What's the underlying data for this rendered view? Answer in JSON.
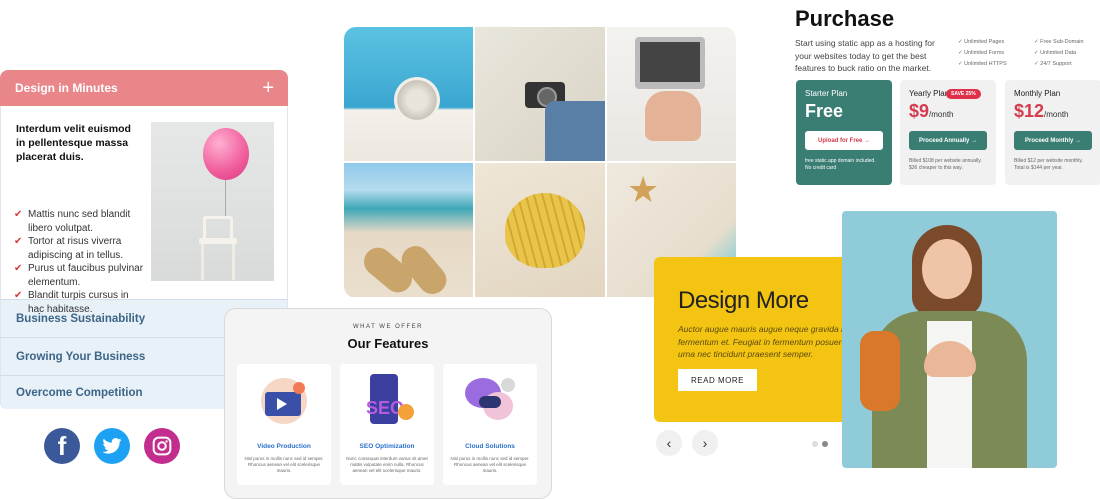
{
  "accordion": {
    "open_title": "Design in Minutes",
    "open_icon": "plus-icon",
    "lead": "Interdum velit euismod in pellentesque massa placerat duis.",
    "items": [
      "Mattis nunc sed blandit libero volutpat.",
      "Tortor at risus viverra adipiscing at in tellus.",
      "Purus ut faucibus pulvinar elementum.",
      "Blandit turpis cursus in hac habitasse."
    ],
    "collapsed": [
      "Business Sustainability",
      "Growing Your Business",
      "Overcome Competition"
    ],
    "accent": "#e8868a"
  },
  "social": {
    "facebook_glyph": "f",
    "icons": [
      "facebook-icon",
      "twitter-icon",
      "instagram-icon"
    ]
  },
  "purchase": {
    "title": "Purchase",
    "description": "Start using static app as a hosting for your websites today to get the best features to buck ratio on the market.",
    "features_col1": [
      "Unlimited Pages",
      "Unlimited Forms",
      "Unlimited HTTPS"
    ],
    "features_col2": [
      "Free Sub-Domain",
      "Unlimited Data",
      "24/7 Support"
    ],
    "plans": [
      {
        "name": "Starter Plan",
        "price": "Free",
        "per": "",
        "badge": "",
        "button": "Upload for Free →",
        "note": "free static.app domain included. No credit card"
      },
      {
        "name": "Yearly Plan",
        "price": "$9",
        "per": "/month",
        "badge": "SAVE 25%",
        "button": "Proceed Annually →",
        "note": "Billed $108 per website annually. $36 cheaper to this way."
      },
      {
        "name": "Monthly Plan",
        "price": "$12",
        "per": "/month",
        "badge": "",
        "button": "Proceed Monthly →",
        "note": "Billed $12 per website monthly. Total is $144 per year."
      }
    ],
    "accent": "#3a7d72"
  },
  "features": {
    "kicker": "WHAT WE OFFER",
    "title": "Our Features",
    "cards": [
      {
        "title": "Video Production",
        "text": "Nisl purus in mollis nunc sed id semper. Rhoncus aenean vel elit scelerisque mauris."
      },
      {
        "title": "SEO Optimization",
        "text": "Nunc consequat interdum varius sit amet mattis vulputate enim nulla. Rhoncus aenean vel elit scelerisque mauris."
      },
      {
        "title": "Cloud Solutions",
        "text": "Nisl purus in mollis nunc sed id semper. Rhoncus aenean vel elit scelerisque mauris."
      }
    ]
  },
  "design_more": {
    "title": "Design More",
    "text": "Auctor augue mauris augue neque gravida in fermentum et. Feugiat in fermentum posuere urna nec tincidunt praesent semper.",
    "button": "READ MORE",
    "prev_glyph": "‹",
    "next_glyph": "›",
    "accent": "#f3c411"
  }
}
